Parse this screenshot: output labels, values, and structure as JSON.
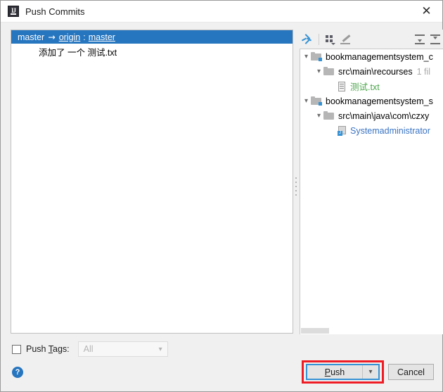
{
  "window": {
    "title": "Push Commits",
    "app_icon": "intellij-idea-icon",
    "close_icon": "close-icon"
  },
  "commits": {
    "branch_row": {
      "source": "master",
      "arrow": "→",
      "remote": "origin",
      "separator": ":",
      "target": "master"
    },
    "messages": [
      {
        "text": "添加了 一个 测试.txt"
      }
    ]
  },
  "tree_toolbar": {
    "buttons": [
      {
        "name": "collapse-arrows-icon",
        "tooltip": "Show Diff"
      },
      {
        "name": "group-by-icon",
        "tooltip": "Group By"
      },
      {
        "name": "edit-source-icon",
        "tooltip": "Edit Source"
      },
      {
        "name": "expand-all-icon",
        "tooltip": "Expand All"
      },
      {
        "name": "collapse-all-icon",
        "tooltip": "Collapse All"
      }
    ]
  },
  "tree": {
    "nodes": [
      {
        "label": "bookmanagementsystem_c",
        "icon": "folder-module-icon",
        "indent": 0,
        "expanded": true,
        "color": "default",
        "count": ""
      },
      {
        "label": "src\\main\\recourses",
        "icon": "folder-icon",
        "indent": 1,
        "expanded": true,
        "color": "default",
        "count": "1 fil"
      },
      {
        "label": "测试.txt",
        "icon": "text-file-icon",
        "indent": 2,
        "expanded": null,
        "color": "green",
        "count": ""
      },
      {
        "label": "bookmanagementsystem_s",
        "icon": "folder-module-icon",
        "indent": 0,
        "expanded": true,
        "color": "default",
        "count": ""
      },
      {
        "label": "src\\main\\java\\com\\czxy",
        "icon": "folder-icon",
        "indent": 1,
        "expanded": true,
        "color": "default",
        "count": ""
      },
      {
        "label": "Systemadministrator",
        "icon": "java-class-icon",
        "indent": 2,
        "expanded": null,
        "color": "blue",
        "count": ""
      }
    ]
  },
  "push_tags": {
    "checked": false,
    "label_prefix": "Push ",
    "label_mnemonic": "T",
    "label_suffix": "ags:",
    "combo_value": "All",
    "combo_enabled": false,
    "chevron_icon": "chevron-down-icon"
  },
  "footer": {
    "help_label": "?",
    "push_prefix": "P",
    "push_suffix": "ush",
    "push_dropdown_icon": "chevron-down-icon",
    "cancel_label": "Cancel"
  },
  "colors": {
    "selection_blue": "#2675bf",
    "focus_blue": "#3592d4",
    "annotation_red": "#ee1c24",
    "added_green": "#4ca64c",
    "modified_blue": "#3a74c4"
  }
}
